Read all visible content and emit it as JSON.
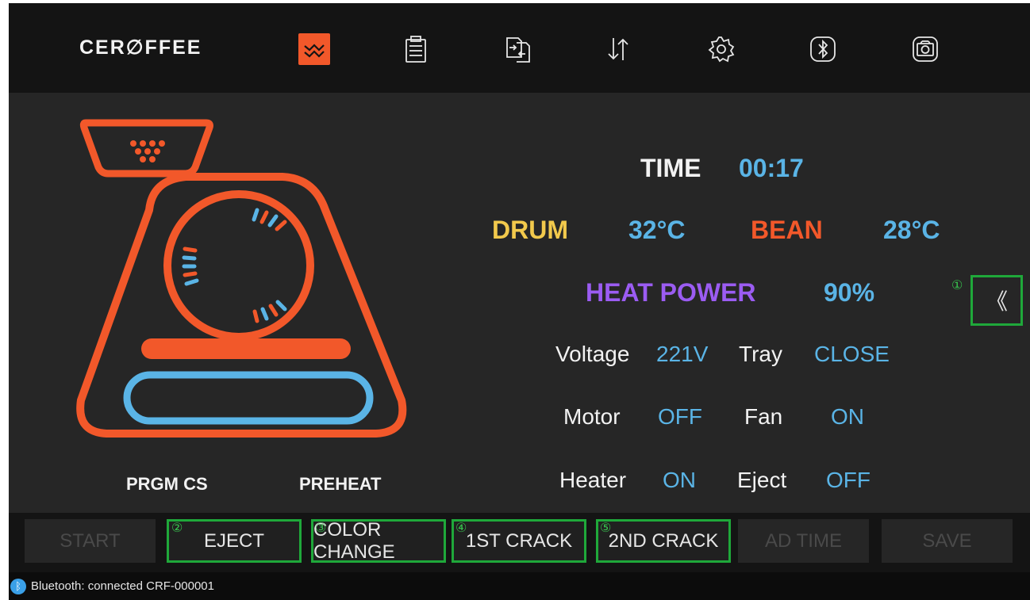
{
  "brand": "CER∅FFEE",
  "nav": [
    {
      "icon": "roast-graph-icon",
      "active": true
    },
    {
      "icon": "clipboard-icon",
      "active": false
    },
    {
      "icon": "file-transfer-icon",
      "active": false
    },
    {
      "icon": "sort-arrows-icon",
      "active": false
    },
    {
      "icon": "gear-icon",
      "active": false
    },
    {
      "icon": "bluetooth-icon",
      "active": false
    },
    {
      "icon": "camera-icon",
      "active": false
    }
  ],
  "readout": {
    "time_label": "TIME",
    "time_value": "00:17",
    "drum_label": "DRUM",
    "drum_value": "32°C",
    "bean_label": "BEAN",
    "bean_value": "28°C",
    "heat_label": "HEAT POWER",
    "heat_value": "90%",
    "voltage_label": "Voltage",
    "voltage_value": "221V",
    "tray_label": "Tray",
    "tray_value": "CLOSE",
    "motor_label": "Motor",
    "motor_value": "OFF",
    "fan_label": "Fan",
    "fan_value": "ON",
    "heater_label": "Heater",
    "heater_value": "ON",
    "eject_label": "Eject",
    "eject_value": "OFF"
  },
  "stages": {
    "left": "PRGM CS",
    "right": "PREHEAT"
  },
  "collapse": {
    "glyph": "《",
    "annotation": "①"
  },
  "actions": [
    {
      "label": "START",
      "enabled": false,
      "annotation": ""
    },
    {
      "label": "EJECT",
      "enabled": true,
      "annotation": "②"
    },
    {
      "label": "COLOR CHANGE",
      "enabled": true,
      "annotation": "③"
    },
    {
      "label": "1ST CRACK",
      "enabled": true,
      "annotation": "④"
    },
    {
      "label": "2ND CRACK",
      "enabled": true,
      "annotation": "⑤"
    },
    {
      "label": "AD TIME",
      "enabled": false,
      "annotation": ""
    },
    {
      "label": "SAVE",
      "enabled": false,
      "annotation": ""
    }
  ],
  "status": {
    "bluetooth_glyph": "ᛒ",
    "text": "Bluetooth: connected  CRF-000001"
  },
  "colors": {
    "accent_orange": "#f2582a",
    "value_blue": "#5ab4e6",
    "drum_yellow": "#f2c94c",
    "heat_purple": "#9b5cf2",
    "highlight_green": "#1fa83a",
    "background": "#262626",
    "bar": "#141414"
  }
}
